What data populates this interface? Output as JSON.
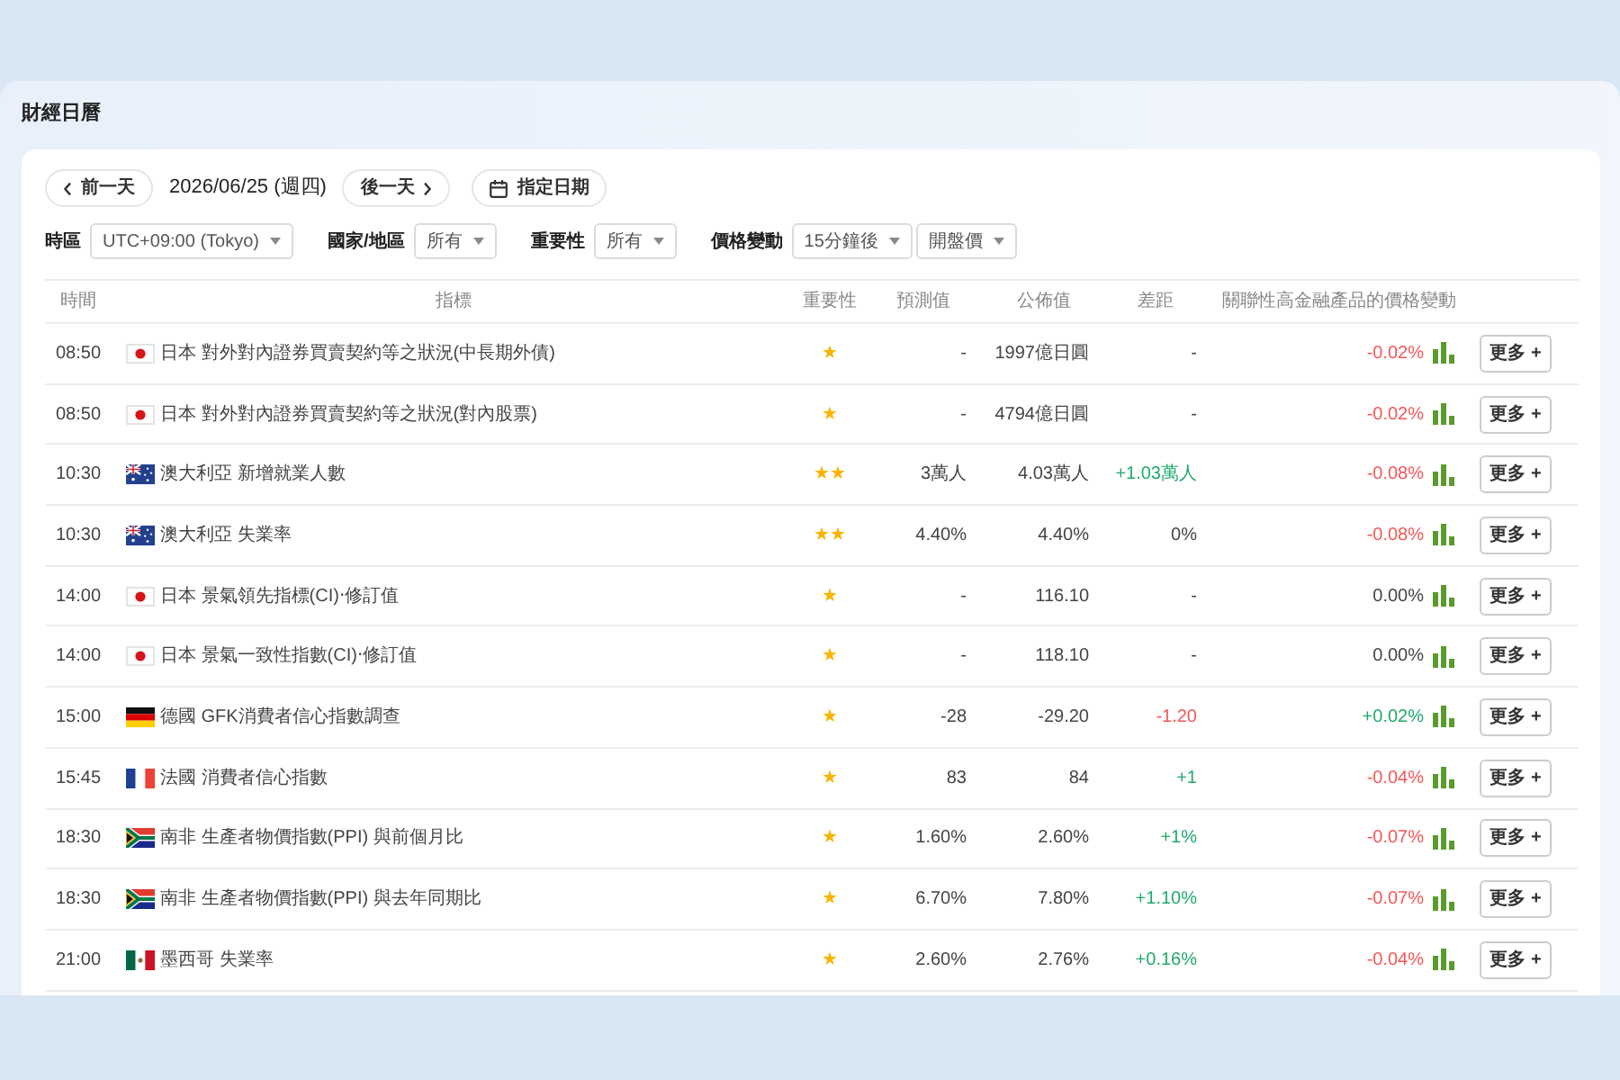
{
  "page_title": "財經日曆",
  "date_nav": {
    "previous": "前一天",
    "date": "2026/06/25 (週四)",
    "next": "後一天",
    "pick_date": "指定日期"
  },
  "filters": [
    {
      "label": "時區",
      "selects": [
        "UTC+09:00 (Tokyo)"
      ]
    },
    {
      "label": "國家/地區",
      "selects": [
        "所有"
      ]
    },
    {
      "label": "重要性",
      "selects": [
        "所有"
      ]
    },
    {
      "label": "價格變動",
      "selects": [
        "15分鐘後",
        "開盤價"
      ]
    }
  ],
  "table": {
    "columns": [
      "時間",
      "指標",
      "重要性",
      "預測值",
      "公佈值",
      "差距",
      "關聯性高金融產品的價格變動"
    ],
    "rows": [
      {
        "time": "08:50",
        "flag": {
          "kind": "japan"
        },
        "indicator": "日本 對外對內證券買賣契約等之狀況(中長期外債)",
        "importance": "★",
        "forecast": "-",
        "actual": "1997億日圓",
        "difference": {
          "text": "-",
          "color": "#444444"
        },
        "price_change": {
          "text": "-0.02%",
          "color": "#f25757"
        },
        "action": "更多 +"
      },
      {
        "time": "08:50",
        "flag": {
          "kind": "japan"
        },
        "indicator": "日本 對外對內證券買賣契約等之狀況(對內股票)",
        "importance": "★",
        "forecast": "-",
        "actual": "4794億日圓",
        "difference": {
          "text": "-",
          "color": "#444444"
        },
        "price_change": {
          "text": "-0.02%",
          "color": "#f25757"
        },
        "action": "更多 +"
      },
      {
        "time": "10:30",
        "flag": {
          "kind": "australia"
        },
        "indicator": "澳大利亞 新增就業人數",
        "importance": "★★",
        "forecast": "3萬人",
        "actual": "4.03萬人",
        "difference": {
          "text": "+1.03萬人",
          "color": "#21a96b"
        },
        "price_change": {
          "text": "-0.08%",
          "color": "#f25757"
        },
        "action": "更多 +"
      },
      {
        "time": "10:30",
        "flag": {
          "kind": "australia"
        },
        "indicator": "澳大利亞 失業率",
        "importance": "★★",
        "forecast": "4.40%",
        "actual": "4.40%",
        "difference": {
          "text": "0%",
          "color": "#444444"
        },
        "price_change": {
          "text": "-0.08%",
          "color": "#f25757"
        },
        "action": "更多 +"
      },
      {
        "time": "14:00",
        "flag": {
          "kind": "japan"
        },
        "indicator": "日本 景氣領先指標(CI)‧修訂值",
        "importance": "★",
        "forecast": "-",
        "actual": "116.10",
        "difference": {
          "text": "-",
          "color": "#444444"
        },
        "price_change": {
          "text": "0.00%",
          "color": "#444444"
        },
        "action": "更多 +"
      },
      {
        "time": "14:00",
        "flag": {
          "kind": "japan"
        },
        "indicator": "日本 景氣一致性指數(CI)‧修訂值",
        "importance": "★",
        "forecast": "-",
        "actual": "118.10",
        "difference": {
          "text": "-",
          "color": "#444444"
        },
        "price_change": {
          "text": "0.00%",
          "color": "#444444"
        },
        "action": "更多 +"
      },
      {
        "time": "15:00",
        "flag": {
          "kind": "germany"
        },
        "indicator": "德國 GFK消費者信心指數調查",
        "importance": "★",
        "forecast": "-28",
        "actual": "-29.20",
        "difference": {
          "text": "-1.20",
          "color": "#f25757"
        },
        "price_change": {
          "text": "+0.02%",
          "color": "#21a96b"
        },
        "action": "更多 +"
      },
      {
        "time": "15:45",
        "flag": {
          "kind": "france"
        },
        "indicator": "法國 消費者信心指數",
        "importance": "★",
        "forecast": "83",
        "actual": "84",
        "difference": {
          "text": "+1",
          "color": "#21a96b"
        },
        "price_change": {
          "text": "-0.04%",
          "color": "#f25757"
        },
        "action": "更多 +"
      },
      {
        "time": "18:30",
        "flag": {
          "kind": "south_africa"
        },
        "indicator": "南非 生產者物價指數(PPI) 與前個月比",
        "importance": "★",
        "forecast": "1.60%",
        "actual": "2.60%",
        "difference": {
          "text": "+1%",
          "color": "#21a96b"
        },
        "price_change": {
          "text": "-0.07%",
          "color": "#f25757"
        },
        "action": "更多 +"
      },
      {
        "time": "18:30",
        "flag": {
          "kind": "south_africa"
        },
        "indicator": "南非 生產者物價指數(PPI) 與去年同期比",
        "importance": "★",
        "forecast": "6.70%",
        "actual": "7.80%",
        "difference": {
          "text": "+1.10%",
          "color": "#21a96b"
        },
        "price_change": {
          "text": "-0.07%",
          "color": "#f25757"
        },
        "action": "更多 +"
      },
      {
        "time": "21:00",
        "flag": {
          "kind": "mexico"
        },
        "indicator": "墨西哥 失業率",
        "importance": "★",
        "forecast": "2.60%",
        "actual": "2.76%",
        "difference": {
          "text": "+0.16%",
          "color": "#21a96b"
        },
        "price_change": {
          "text": "-0.04%",
          "color": "#f25757"
        },
        "action": "更多 +"
      }
    ]
  }
}
